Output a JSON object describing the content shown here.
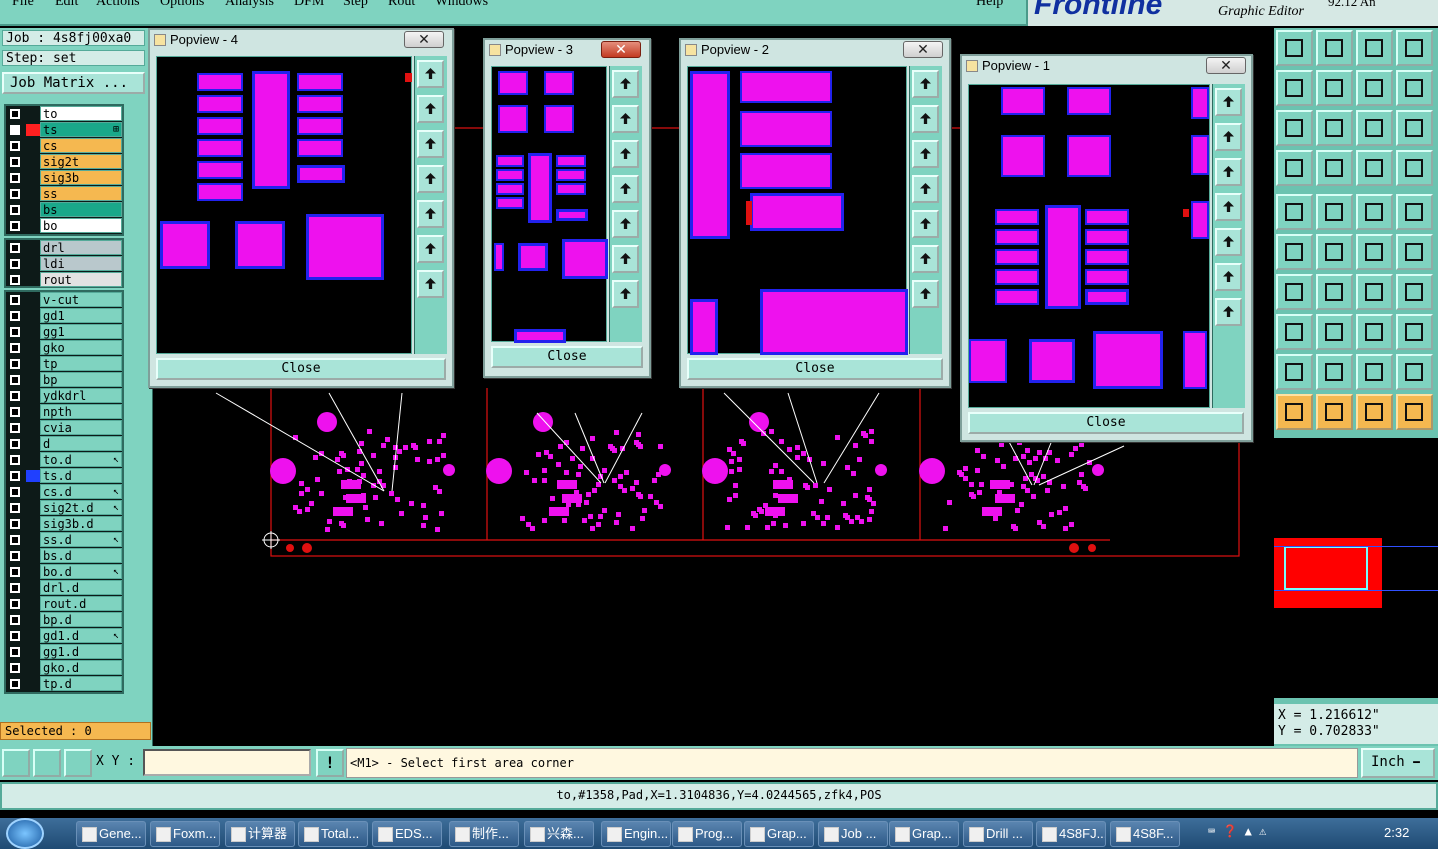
{
  "menubar": {
    "items": [
      "File",
      "Edit",
      "Actions",
      "Options",
      "Analysis",
      "DFM",
      "Step",
      "Rout",
      "Windows",
      "Help"
    ]
  },
  "brand": {
    "logo": "Frontline",
    "subtitle": "Graphic Editor",
    "version": "92.12 An"
  },
  "job": {
    "label": "Job : 4s8fj00xa0",
    "step": "Step: set",
    "matrix_button": "Job Matrix ..."
  },
  "layers": {
    "signal": [
      {
        "name": "to",
        "color": "#ffffff",
        "swatch": ""
      },
      {
        "name": "ts",
        "color": "#1aa88a",
        "swatch": "#ff2020",
        "selected": true,
        "mark": "⊞"
      },
      {
        "name": "cs",
        "color": "#f5b850",
        "swatch": ""
      },
      {
        "name": "sig2t",
        "color": "#f5b850",
        "swatch": ""
      },
      {
        "name": "sig3b",
        "color": "#f5b850",
        "swatch": ""
      },
      {
        "name": "ss",
        "color": "#f5b850",
        "swatch": ""
      },
      {
        "name": "bs",
        "color": "#1aa88a",
        "swatch": ""
      },
      {
        "name": "bo",
        "color": "#ffffff",
        "swatch": ""
      }
    ],
    "drill": [
      {
        "name": "drl",
        "color": "#b9c8cc"
      },
      {
        "name": "ldi",
        "color": "#b9c8cc"
      },
      {
        "name": "rout",
        "color": "#e2e2e2"
      }
    ],
    "misc": [
      {
        "name": "v-cut",
        "color": "#7fd3c0"
      },
      {
        "name": "gd1",
        "color": "#7fd3c0"
      },
      {
        "name": "gg1",
        "color": "#7fd3c0"
      },
      {
        "name": "gko",
        "color": "#7fd3c0"
      },
      {
        "name": "tp",
        "color": "#7fd3c0"
      },
      {
        "name": "bp",
        "color": "#7fd3c0"
      },
      {
        "name": "ydkdrl",
        "color": "#7fd3c0"
      },
      {
        "name": "npth",
        "color": "#7fd3c0"
      },
      {
        "name": "cvia",
        "color": "#7fd3c0"
      },
      {
        "name": "d",
        "color": "#7fd3c0"
      },
      {
        "name": "to.d",
        "color": "#7fd3c0",
        "mark": "↖"
      },
      {
        "name": "ts.d",
        "color": "#7fd3c0",
        "swatch": "#2040ff"
      },
      {
        "name": "cs.d",
        "color": "#7fd3c0",
        "mark": "↖"
      },
      {
        "name": "sig2t.d",
        "color": "#7fd3c0",
        "mark": "↖"
      },
      {
        "name": "sig3b.d",
        "color": "#7fd3c0"
      },
      {
        "name": "ss.d",
        "color": "#7fd3c0",
        "mark": "↖"
      },
      {
        "name": "bs.d",
        "color": "#7fd3c0"
      },
      {
        "name": "bo.d",
        "color": "#7fd3c0",
        "mark": "↖"
      },
      {
        "name": "drl.d",
        "color": "#7fd3c0"
      },
      {
        "name": "rout.d",
        "color": "#7fd3c0"
      },
      {
        "name": "bp.d",
        "color": "#7fd3c0"
      },
      {
        "name": "gd1.d",
        "color": "#7fd3c0",
        "mark": "↖"
      },
      {
        "name": "gg1.d",
        "color": "#7fd3c0"
      },
      {
        "name": "gko.d",
        "color": "#7fd3c0"
      },
      {
        "name": "tp.d",
        "color": "#7fd3c0"
      }
    ]
  },
  "selected_label": "Selected : 0",
  "popviews": [
    {
      "title": "Popview - 4",
      "close": "Close",
      "x": "✕"
    },
    {
      "title": "Popview - 3",
      "close": "Close",
      "x": "✕"
    },
    {
      "title": "Popview - 2",
      "close": "Close",
      "x": "✕"
    },
    {
      "title": "Popview - 1",
      "close": "Close",
      "x": "✕"
    }
  ],
  "coords": {
    "x": "X = 1.216612\"",
    "y": "Y = 0.702833\""
  },
  "cmd": {
    "xy_label": "X Y :",
    "message": "<M1> - Select first area corner",
    "units": "Inch"
  },
  "status_text": "to,#1358,Pad,X=1.3104836,Y=4.0244565,zfk4,POS",
  "taskbar": {
    "items": [
      "Gene...",
      "Foxm...",
      "计算器",
      "Total...",
      "EDS...",
      "制作...",
      "兴森...",
      "Engin...",
      "Prog...",
      "Grap...",
      "Job ...",
      "Grap...",
      "Drill ...",
      "4S8FJ...",
      "4S8F..."
    ],
    "clock": "2:32"
  },
  "colors": {
    "panel": "#7fd3c0",
    "pad": "#ee11ee",
    "outline": "#2222ee",
    "board": "#ff0000"
  }
}
